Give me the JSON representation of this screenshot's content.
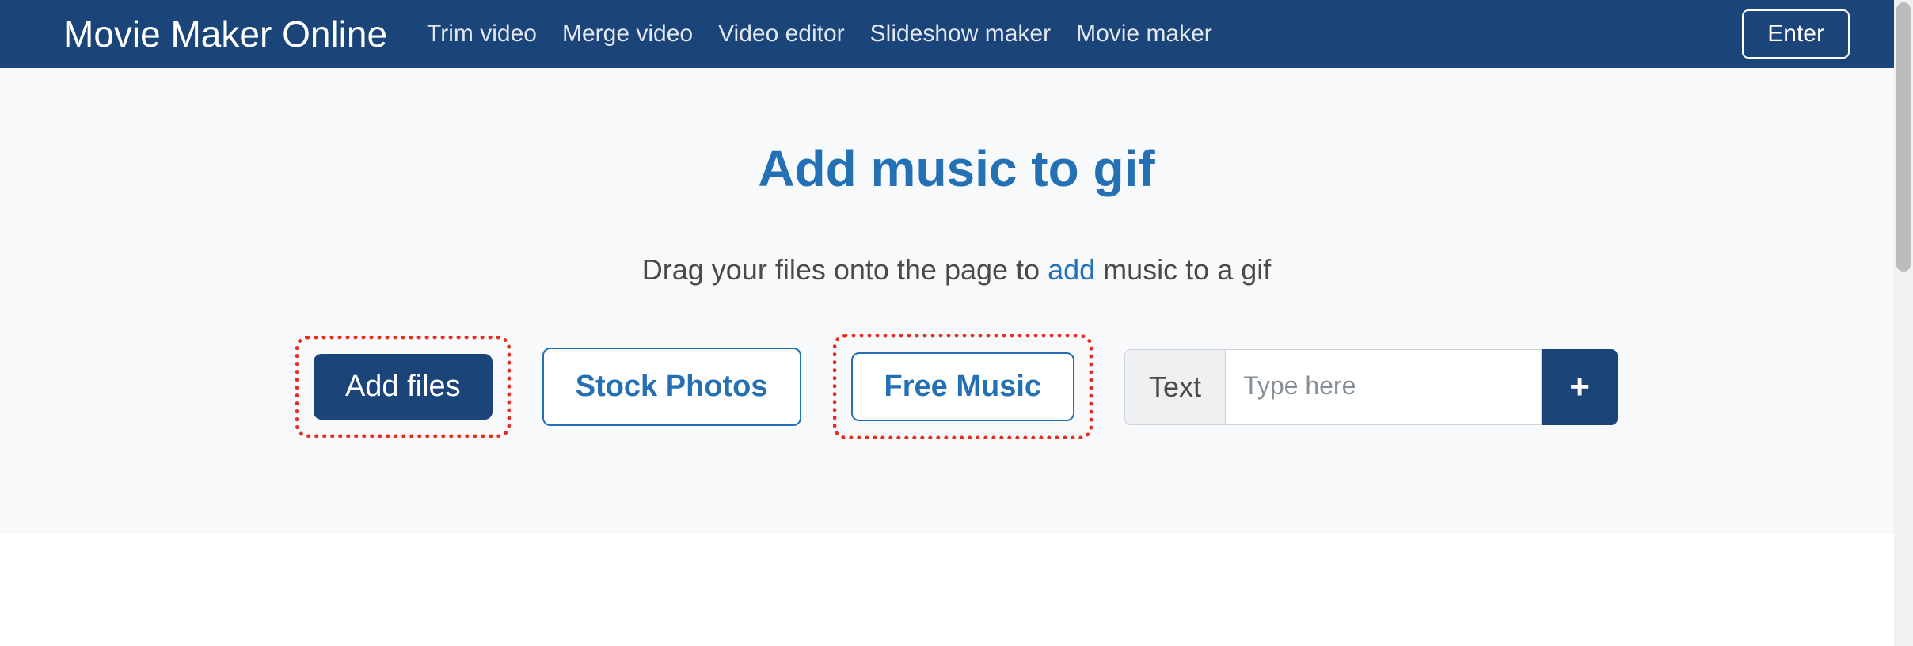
{
  "header": {
    "logo": "Movie Maker Online",
    "nav": [
      "Trim video",
      "Merge video",
      "Video editor",
      "Slideshow maker",
      "Movie maker"
    ],
    "enter": "Enter"
  },
  "hero": {
    "title": "Add music to gif",
    "subtitle_before": "Drag your files onto the page to ",
    "subtitle_link": "add",
    "subtitle_after": " music to a gif"
  },
  "controls": {
    "add_files": "Add files",
    "stock_photos": "Stock Photos",
    "free_music": "Free Music",
    "text_label": "Text",
    "text_placeholder": "Type here",
    "plus": "+"
  }
}
